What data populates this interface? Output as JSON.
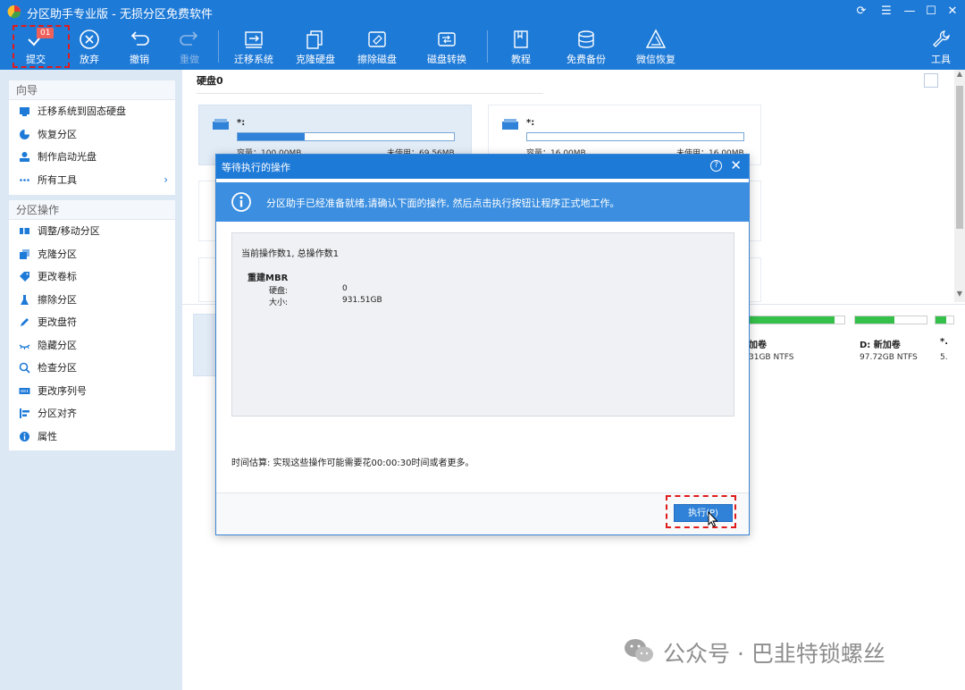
{
  "window": {
    "title": "分区助手专业版 - 无损分区免费软件",
    "controls": [
      "refresh-icon",
      "menu-icon",
      "minimize-icon",
      "maximize-icon",
      "close-icon"
    ]
  },
  "toolbar": {
    "submit": {
      "label": "提交",
      "badge": "01"
    },
    "discard": {
      "label": "放弃"
    },
    "undo": {
      "label": "撤销"
    },
    "redo": {
      "label": "重做"
    },
    "migrate": {
      "label": "迁移系统"
    },
    "clone": {
      "label": "克隆硬盘"
    },
    "wipe": {
      "label": "擦除磁盘"
    },
    "convert": {
      "label": "磁盘转换"
    },
    "tutorial": {
      "label": "教程"
    },
    "backup": {
      "label": "免费备份"
    },
    "wechat": {
      "label": "微信恢复"
    },
    "tools": {
      "label": "工具"
    }
  },
  "sidebar": {
    "wizard": {
      "title": "向导",
      "items": [
        {
          "label": "迁移系统到固态硬盘",
          "icon": "migrate-icon"
        },
        {
          "label": "恢复分区",
          "icon": "recover-icon"
        },
        {
          "label": "制作启动光盘",
          "icon": "bootdisk-icon"
        },
        {
          "label": "所有工具",
          "icon": "more-icon"
        }
      ]
    },
    "partition_ops": {
      "title": "分区操作",
      "items": [
        {
          "label": "调整/移动分区",
          "icon": "resize-icon"
        },
        {
          "label": "克隆分区",
          "icon": "clone-partition-icon"
        },
        {
          "label": "更改卷标",
          "icon": "label-icon"
        },
        {
          "label": "擦除分区",
          "icon": "wipe-partition-icon"
        },
        {
          "label": "更改盘符",
          "icon": "drive-letter-icon"
        },
        {
          "label": "隐藏分区",
          "icon": "hide-icon"
        },
        {
          "label": "检查分区",
          "icon": "check-icon"
        },
        {
          "label": "更改序列号",
          "icon": "serial-icon"
        },
        {
          "label": "分区对齐",
          "icon": "align-icon"
        },
        {
          "label": "属性",
          "icon": "info-icon"
        }
      ]
    }
  },
  "main": {
    "disk_label": "硬盘0",
    "partitions": [
      {
        "name": "*:",
        "capacity": "容量：100.00MB",
        "free": "未使用：69.56MB",
        "used_fraction": 0.31
      },
      {
        "name": "*:",
        "capacity": "容量：16.00MB",
        "free": "未使用：16.00MB",
        "used_fraction": 0.0
      }
    ],
    "disk_map": [
      {
        "name": "加卷",
        "info": "31GB NTFS",
        "used_fraction": 0.9
      },
      {
        "name": "D: 新加卷",
        "info": "97.72GB NTFS",
        "used_fraction": 0.55
      },
      {
        "name": "*.",
        "info": "5.",
        "used_fraction": 0.6
      }
    ]
  },
  "dialog": {
    "title": "等待执行的操作",
    "banner": "分区助手已经准备就绪,请确认下面的操作, 然后点击执行按钮让程序正式地工作。",
    "op_count": "当前操作数1, 总操作数1",
    "operation": {
      "name": "重建MBR",
      "rows": [
        {
          "key": "硬盘:",
          "value": "0"
        },
        {
          "key": "大小:",
          "value": "931.51GB"
        }
      ]
    },
    "estimate": "时间估算: 实现这些操作可能需要花00:00:30时间或者更多。",
    "execute_button": "执行(P)"
  },
  "watermark": "公众号 · 巴韭特锁螺丝",
  "colors": {
    "primary": "#1e7ad7",
    "banner": "#3c8fe0",
    "highlight_box": "#e01b1b",
    "usage_green": "#35c04a"
  }
}
